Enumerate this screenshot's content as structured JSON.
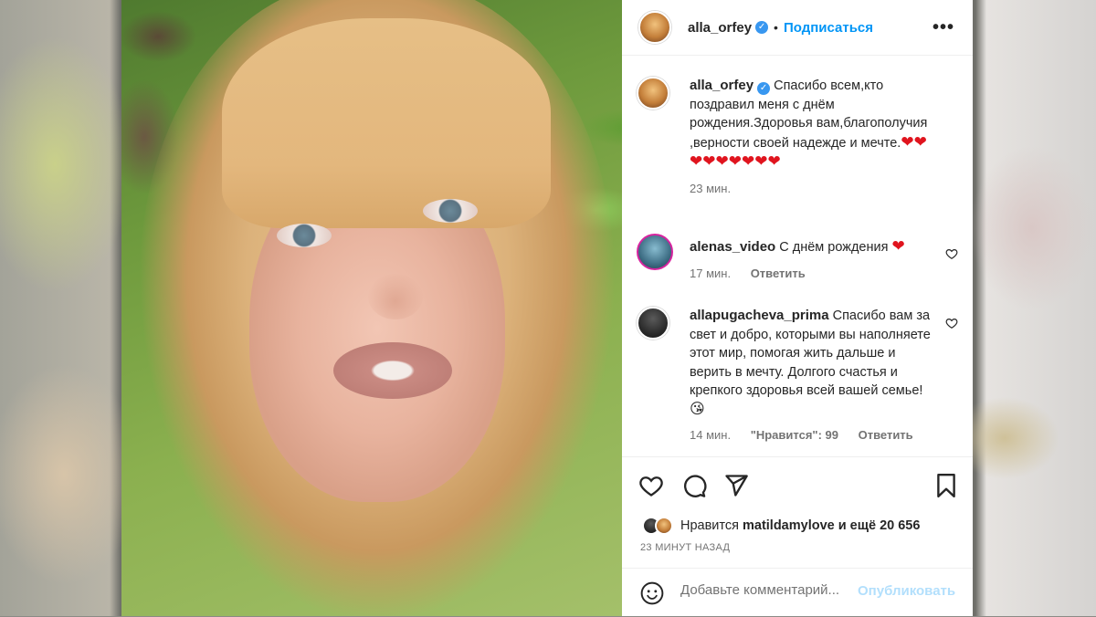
{
  "post": {
    "author": "alla_orfey",
    "verified_mark": "✓",
    "dot": "•",
    "follow_label": "Подписаться",
    "more_icon": "more-icon",
    "photo_description_icon": "photo"
  },
  "caption": {
    "author": "alla_orfey",
    "verified_mark": "✓",
    "text": "Спасибо всем,кто поздравил меня с днём рождения.Здоровья вам,благополучия ,верности своей надежде и мечте.",
    "hearts": "❤❤❤❤❤❤❤❤❤",
    "time": "23 мин."
  },
  "comments": [
    {
      "author": "alenas_video",
      "text": "С днём рождения",
      "emoji": "❤",
      "time": "17 мин.",
      "likes": "",
      "reply_label": "Ответить"
    },
    {
      "author": "allapugacheva_prima",
      "text": "Спасибо вам за свет и добро, которыми вы наполняете этот мир, помогая жить дальше и верить в мечту. Долгого счастья и крепкого здоровья всей вашей семье!",
      "emoji": "😘",
      "time": "14 мин.",
      "likes": "\"Нравится\": 99",
      "reply_label": "Ответить"
    }
  ],
  "likes": {
    "prefix": "Нравится",
    "user": "matildamylove",
    "suffix": "и ещё 20 656"
  },
  "posted_ago": "23 МИНУТ НАЗАД",
  "comment_box": {
    "placeholder": "Добавьте комментарий...",
    "publish_label": "Опубликовать"
  },
  "colors": {
    "accent": "#0095f6",
    "publish_disabled": "#b2dffc",
    "heart": "#e0141e",
    "text": "#262626",
    "muted": "#737373"
  }
}
